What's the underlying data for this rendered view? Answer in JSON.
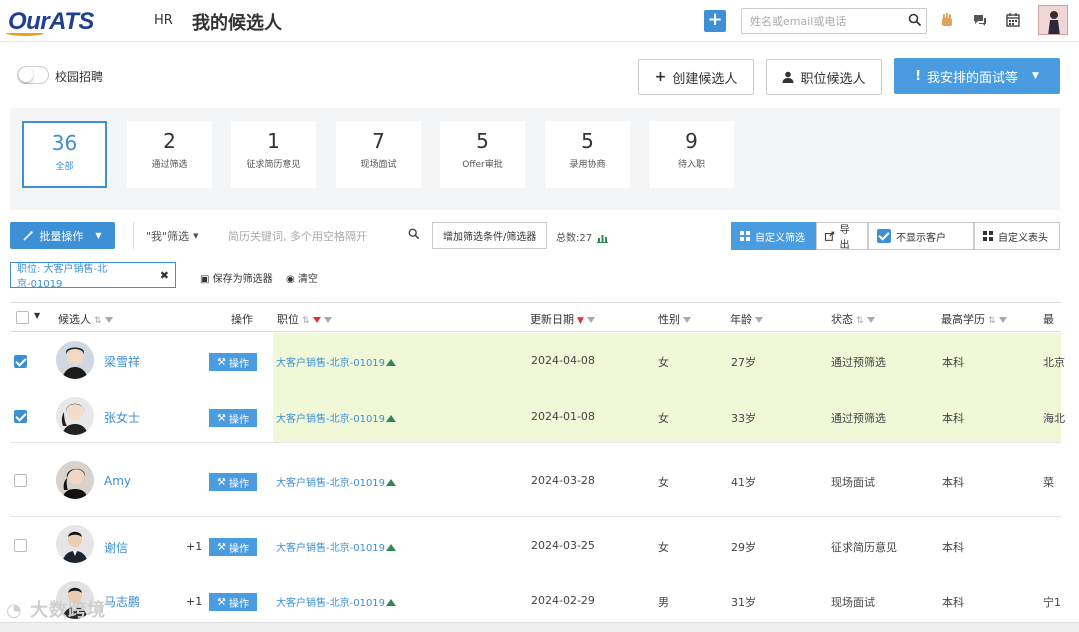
{
  "header": {
    "logo": "OurATS",
    "module": "HR",
    "title": "我的候选人",
    "search_placeholder": "姓名或email或电话"
  },
  "campus": {
    "label": "校园招聘",
    "enabled": false
  },
  "actions": {
    "create": "创建候选人",
    "job_candidates": "职位候选人",
    "my_interviews": "我安排的面试等"
  },
  "stats": [
    {
      "count": "36",
      "label": "全部",
      "active": true
    },
    {
      "count": "2",
      "label": "通过筛选"
    },
    {
      "count": "1",
      "label": "征求简历意见"
    },
    {
      "count": "7",
      "label": "现场面试"
    },
    {
      "count": "5",
      "label": "Offer审批"
    },
    {
      "count": "5",
      "label": "录用协商"
    },
    {
      "count": "9",
      "label": "待入职"
    }
  ],
  "toolbar": {
    "batch": "批量操作",
    "filter": "\"我\"筛选",
    "keyword_placeholder": "简历关键词, 多个用空格隔开",
    "add_condition": "增加筛选条件/筛选器",
    "total": "总数:27",
    "custom_filter": "自定义筛选",
    "export": "导出",
    "hide_client": "不显示客户",
    "custom_columns": "自定义表头"
  },
  "active_filter": {
    "chip": "职位: 大客户销售-北京-01019",
    "save": "保存为筛选器",
    "clear": "清空"
  },
  "table": {
    "headers": {
      "candidate": "候选人",
      "action": "操作",
      "job": "职位",
      "updated": "更新日期",
      "gender": "性别",
      "age": "年龄",
      "status": "状态",
      "education": "最高学历",
      "last": "最"
    },
    "op_label": "操作",
    "rows": [
      {
        "name": "梁雪祥",
        "plus": "",
        "job": "大客户销售-北京-01019",
        "date": "2024-04-08",
        "gender": "女",
        "age": "27岁",
        "status": "通过预筛选",
        "education": "本科",
        "extra": "北京",
        "checked": true,
        "highlight": true
      },
      {
        "name": "张女士",
        "plus": "",
        "job": "大客户销售-北京-01019",
        "date": "2024-01-08",
        "gender": "女",
        "age": "33岁",
        "status": "通过预筛选",
        "education": "本科",
        "extra": "海北",
        "checked": true,
        "highlight": true
      },
      {
        "name": "Amy",
        "plus": "",
        "job": "大客户销售-北京-01019",
        "date": "2024-03-28",
        "gender": "女",
        "age": "41岁",
        "status": "现场面试",
        "education": "本科",
        "extra": "菜",
        "checked": false,
        "highlight": false
      },
      {
        "name": "谢信",
        "plus": "+1",
        "job": "大客户销售-北京-01019",
        "date": "2024-03-25",
        "gender": "女",
        "age": "29岁",
        "status": "征求简历意见",
        "education": "本科",
        "extra": "",
        "checked": false,
        "highlight": false
      },
      {
        "name": "马志鹏",
        "plus": "+1",
        "job": "大客户销售-北京-01019",
        "date": "2024-02-29",
        "gender": "男",
        "age": "31岁",
        "status": "现场面试",
        "education": "本科",
        "extra": "宁1",
        "checked": false,
        "highlight": false
      }
    ]
  },
  "watermark": "大数跨境",
  "colors": {
    "accent": "#3d8fd6",
    "highlight": "#f1f8d8",
    "brand": "#1f3f8f"
  }
}
